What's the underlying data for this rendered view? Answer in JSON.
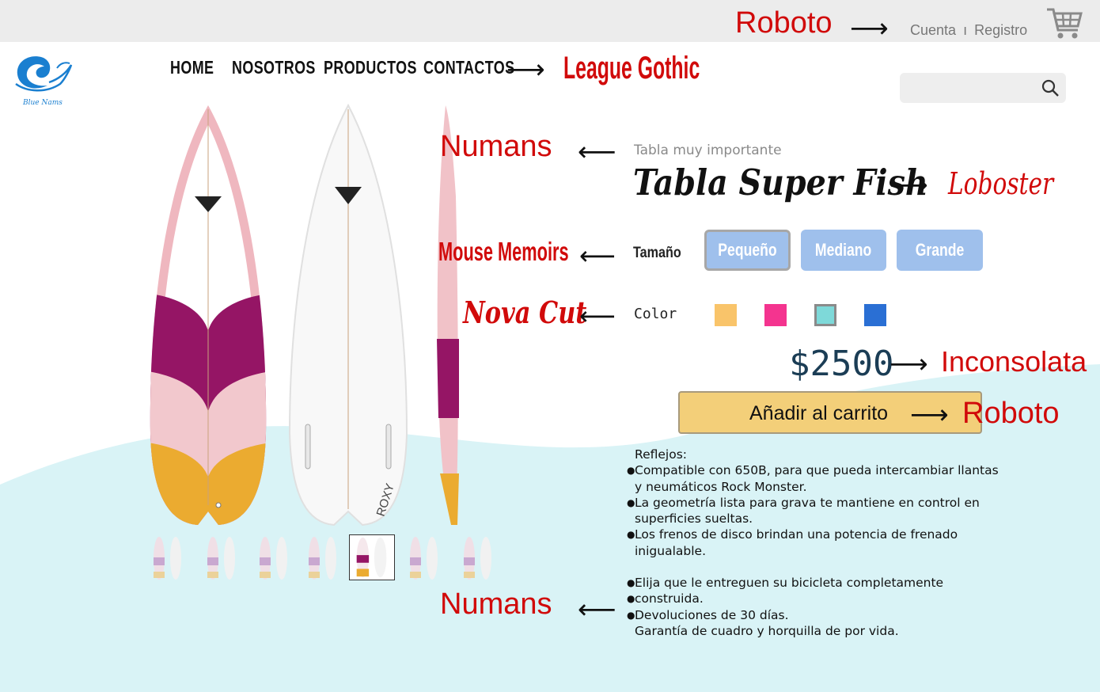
{
  "header": {
    "account_link": "Cuenta",
    "separator": "ı",
    "register_link": "Registro",
    "brand_name": "Blue Nams",
    "cart_icon": "cart-icon"
  },
  "nav": {
    "items": [
      "HOME",
      "NOSOTROS",
      "PRODUCTOS",
      "CONTACTOS"
    ]
  },
  "search": {
    "placeholder": "",
    "icon": "search-icon"
  },
  "product": {
    "subtitle": "Tabla muy importante",
    "title": "Tabla Super Fish",
    "size_label": "Tamaño",
    "sizes": [
      "Pequeño",
      "Mediano",
      "Grande"
    ],
    "selected_size": "Pequeño",
    "color_label": "Color",
    "colors": [
      "#f9c46a",
      "#f4348f",
      "#7ed9d9",
      "#2a6fd4"
    ],
    "price": "$2500",
    "add_to_cart": "Añadir al carrito",
    "board_brand": "ROXY",
    "description": [
      "Reflejos:",
      "Compatible con 650B, para que pueda intercambiar llantas",
      "y neumáticos Rock Monster.",
      "La geometría lista para grava te mantiene en control en",
      "superficies sueltas.",
      "Los frenos de disco brindan una potencia de frenado",
      "inigualable.",
      "Elija que le entreguen su bicicleta completamente",
      "construida.",
      "Devoluciones de 30 días.",
      "Garantía de cuadro y horquilla de por vida."
    ],
    "thumbnail_count": 7,
    "selected_thumbnail": 5
  },
  "annotations": {
    "roboto_top": "Roboto",
    "league_gothic": "League Gothic",
    "numans_top": "Numans",
    "loboster": "Loboster",
    "mouse_memoirs": "Mouse Memoirs",
    "nova_cut": "Nova Cut",
    "inconsolata": "Inconsolata",
    "roboto_button": "Roboto",
    "numans_bottom": "Numans"
  },
  "colors": {
    "annotation_red": "#d10a0a",
    "button_blue": "#9fc0ec",
    "cart_button": "#f3cf79",
    "wave": "#d9f3f6",
    "price": "#1b3d55"
  }
}
